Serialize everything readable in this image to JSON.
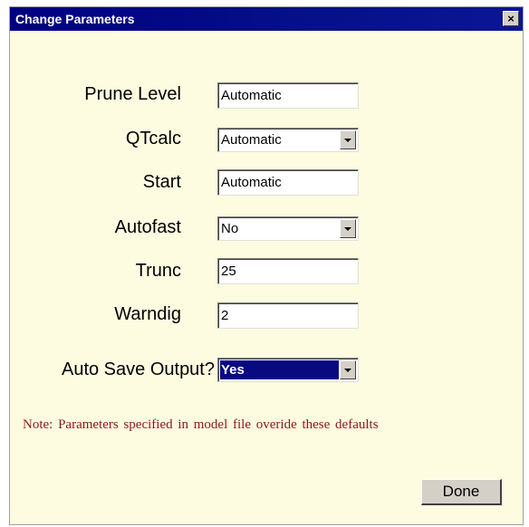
{
  "window": {
    "title": "Change Parameters",
    "close_symbol": "×"
  },
  "fields": {
    "prune_level": {
      "label": "Prune Level",
      "value": "Automatic"
    },
    "qtcalc": {
      "label": "QTcalc",
      "value": "Automatic"
    },
    "start": {
      "label": "Start",
      "value": "Automatic"
    },
    "autofast": {
      "label": "Autofast",
      "value": "No"
    },
    "trunc": {
      "label": "Trunc",
      "value": "25"
    },
    "warndig": {
      "label": "Warndig",
      "value": "2"
    },
    "auto_save": {
      "label": "Auto Save Output?",
      "value": "Yes"
    }
  },
  "note": "Note:  Parameters specified in model  file  overide  these defaults",
  "done_label": "Done",
  "icons": {
    "close": "close-icon",
    "dropdown": "chevron-down-icon"
  },
  "colors": {
    "titlebar": "#000080",
    "background": "#fdfbe0",
    "note_text": "#8b1a1a",
    "selection": "#0a0a80"
  }
}
